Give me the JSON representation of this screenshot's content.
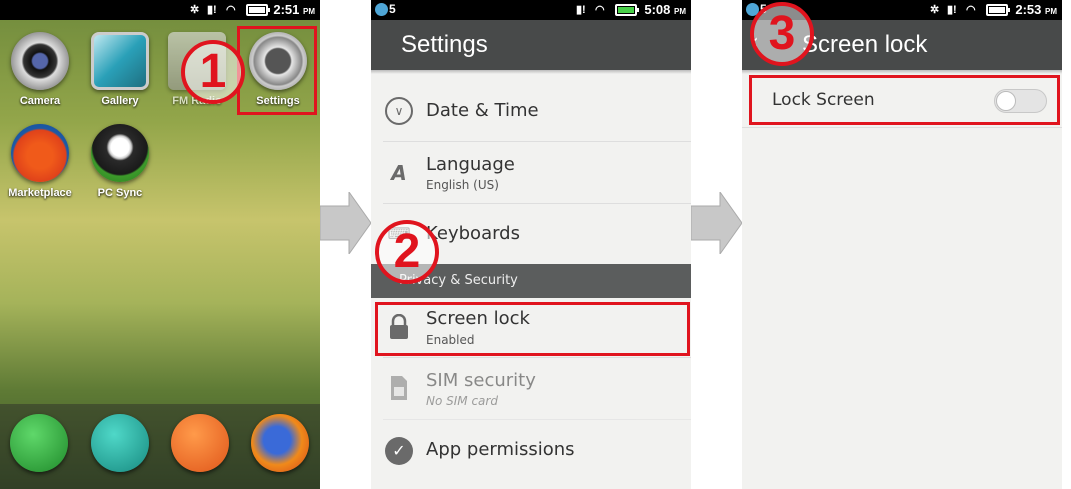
{
  "panel1": {
    "status_time": "2:51",
    "status_ampm": "PM",
    "apps": [
      {
        "label": "Camera",
        "icon": "camera-icon"
      },
      {
        "label": "Gallery",
        "icon": "gallery-icon"
      },
      {
        "label": "FM Radio",
        "icon": "radio-icon"
      },
      {
        "label": "Settings",
        "icon": "settings-gear-icon"
      },
      {
        "label": "Marketplace",
        "icon": "marketplace-icon"
      },
      {
        "label": "PC Sync",
        "icon": "usb-icon"
      }
    ],
    "dock": [
      "phone-icon",
      "messages-icon",
      "contacts-icon",
      "firefox-icon"
    ],
    "step_badge": "1"
  },
  "panel2": {
    "status_notif": "5",
    "status_time": "5:08",
    "status_ampm": "PM",
    "header_title": "Settings",
    "rows": {
      "date_time": "Date & Time",
      "language": "Language",
      "language_sub": "English (US)",
      "keyboards": "Keyboards",
      "section": "Privacy & Security",
      "screen_lock": "Screen lock",
      "screen_lock_sub": "Enabled",
      "sim_security": "SIM security",
      "sim_security_sub": "No SIM card",
      "app_permissions": "App permissions"
    },
    "step_badge": "2"
  },
  "panel3": {
    "status_notif": "5",
    "status_time": "2:53",
    "status_ampm": "PM",
    "header_title": "Screen lock",
    "lock_screen_label": "Lock Screen",
    "lock_screen_enabled": false,
    "step_badge": "3"
  },
  "colors": {
    "highlight": "#e0141e",
    "header": "#484a4a",
    "section": "#5b5d5d"
  }
}
